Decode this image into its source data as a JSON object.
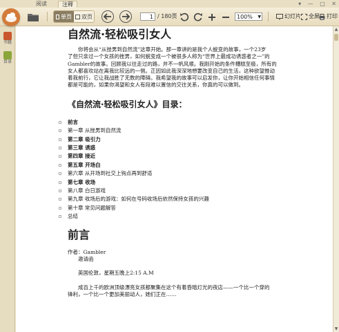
{
  "tabs": [
    {
      "label": "阅读",
      "active": false
    },
    {
      "label": "注释",
      "active": true
    }
  ],
  "window_controls": [
    "▾",
    "—",
    "□",
    "✕"
  ],
  "toolbar": {
    "single_page_label": "单页",
    "double_page_label": "双页",
    "current_page": "1",
    "total_pages": "/ 180页",
    "zoom_value": "100%",
    "slideshow_label": "幻灯片",
    "fullscreen_label": "全屏",
    "print_label": "打印"
  },
  "sidebar": {
    "items": [
      {
        "label": "书籍",
        "icon": "book-icon"
      },
      {
        "label": "目录",
        "icon": "toc-icon"
      }
    ]
  },
  "document": {
    "title": "自然流·轻松吸引女人",
    "intro_lines": [
      "　　你将会从“从挫男到自然流”这章开始。那一章讲的是我个人蜕变的故事，一个23岁",
      "了但只亲过一个女孩的挫男，如何蜕变成一个被很多人称为“世界上最成功诱惑者之一”的",
      "Gambler的故事。回顾我以往走过的路，并不一帆风顺。我刚开始的条件糟糕至极，所有的",
      "女人都喜欢站在离我比较远的一侧。正因如此我深深地想要改变自己的生活，这种欲望推动",
      "着我前行，它让我战胜了无数的障碍。我希望我的故事可以启发你，让你开始相信任何事情",
      "都是可能的，如果你渴望和女人有段难以置信的交往关系，你真的可以做到。"
    ],
    "toc_heading": "《自然流·轻松吸引女人》目录：",
    "toc": [
      {
        "label": "前言",
        "bold": true
      },
      {
        "label": "第一章 从挫男到自然流",
        "bold": false
      },
      {
        "label": "第二章 吸引力",
        "bold": true
      },
      {
        "label": "第三章 诱惑",
        "bold": true
      },
      {
        "label": "第四章 接近",
        "bold": true
      },
      {
        "label": "第五章 开场白",
        "bold": true
      },
      {
        "label": "第六章 从开场到社交上钩点再到舒适",
        "bold": false
      },
      {
        "label": "第七章 收场",
        "bold": true
      },
      {
        "label": "第八章 白日游戏",
        "bold": false
      },
      {
        "label": "第九章 收场后的游戏：如何在号码收场后依然保持女孩的兴趣",
        "bold": false
      },
      {
        "label": "第十章 常见问题解答",
        "bold": false
      },
      {
        "label": "总结",
        "bold": false
      }
    ],
    "preface_heading": "前言",
    "author_line": "作者：Gambler",
    "invitation": "　　邀请函",
    "time_line": "　　英国伦敦，星期五晚上2:15 A.M",
    "body_lines": [
      "　　成百上千的欧洲顶级漂亮女孩都聚集在这个有着昏暗灯光的夜店——一个比一个穿的",
      "锋利，一个比一个更加美丽动人，她们正在……"
    ]
  },
  "colors": {
    "app_background": "#efe6cf",
    "logo_orange": "#d37b39",
    "toolbar_toggle_active": "#8a7d62"
  }
}
